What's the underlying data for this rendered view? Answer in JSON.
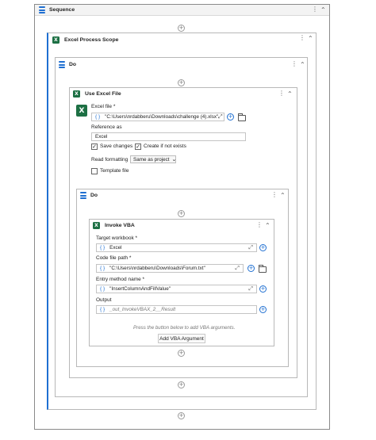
{
  "sequence": {
    "title": "Sequence"
  },
  "excel_process_scope": {
    "title": "Excel Process Scope"
  },
  "outer_do": {
    "title": "Do"
  },
  "use_excel_file": {
    "title": "Use Excel File",
    "excel_file_label": "Excel file *",
    "excel_file_value": "\"C:\\Users\\nrdabberu\\Downloads\\challenge (4).xlsx\"",
    "reference_as_label": "Reference as",
    "reference_as_value": "Excel",
    "save_changes_label": "Save changes",
    "create_if_not_exists_label": "Create if not exists",
    "read_formatting_label": "Read formatting",
    "read_formatting_value": "Same as project",
    "template_file_label": "Template file"
  },
  "inner_do": {
    "title": "Do"
  },
  "invoke_vba": {
    "title": "Invoke VBA",
    "target_workbook_label": "Target workbook *",
    "target_workbook_value": "Excel",
    "code_file_path_label": "Code file path *",
    "code_file_path_value": "\"C:\\Users\\nrdabberu\\Downloads\\Forum.txt\"",
    "entry_method_label": "Entry method name *",
    "entry_method_value": "\"InsertColumnAndFillValue\"",
    "output_label": "Output",
    "output_value": "_out_InvokeVBAX_2__Result",
    "hint": "Press the button below to add VBA arguments.",
    "add_argument_label": "Add VBA Argument"
  },
  "glyphs": {
    "more": "⋮",
    "collapse": "⌃",
    "plus": "+",
    "brace": "{ }",
    "expand": "⤢",
    "check": "✓",
    "chevron": "⌄",
    "excel_letter": "X"
  },
  "colors": {
    "accent": "#1f6fd1",
    "excel_green": "#1d7044"
  }
}
